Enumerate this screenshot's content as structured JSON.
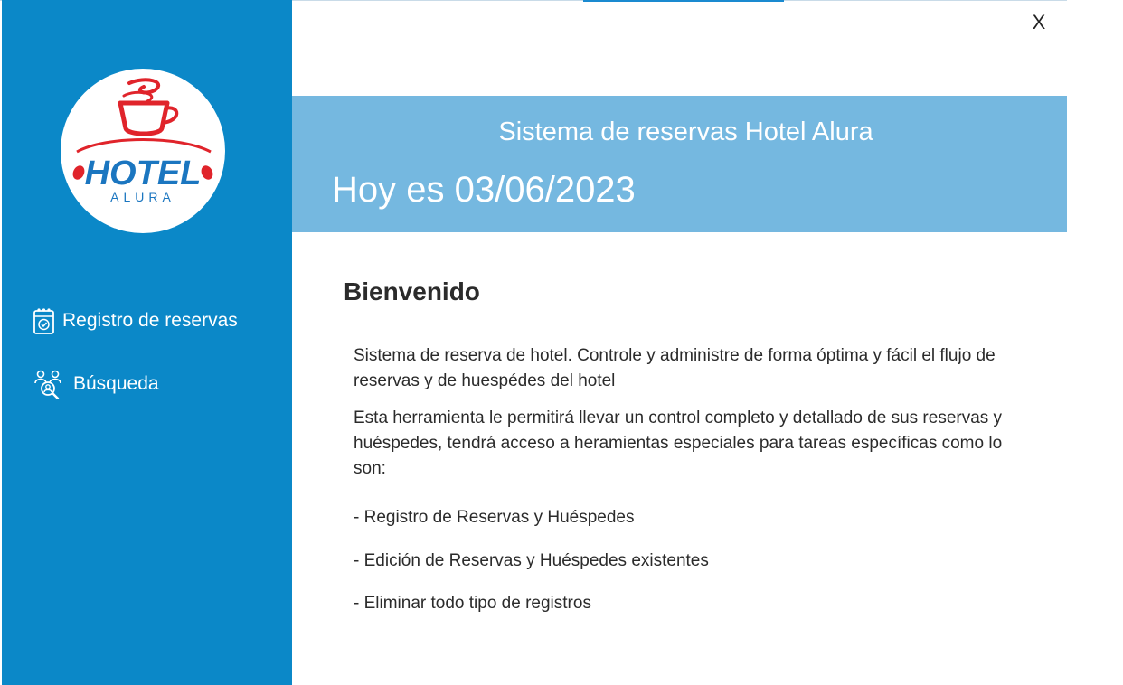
{
  "window": {
    "close_label": "X"
  },
  "sidebar": {
    "logo": {
      "title": "HOTEL",
      "subtitle": "ALURA"
    },
    "items": [
      {
        "label": "Registro de reservas",
        "icon": "reservation-calendar-icon"
      },
      {
        "label": "Búsqueda",
        "icon": "people-search-icon"
      }
    ]
  },
  "header": {
    "title": "Sistema de reservas Hotel Alura",
    "date_text": "Hoy es 03/06/2023"
  },
  "main": {
    "welcome_title": "Bienvenido",
    "paragraph_1": "Sistema de reserva de hotel. Controle y administre de forma óptima y fácil el flujo de reservas y de huespédes del hotel",
    "paragraph_2": "Esta herramienta le permitirá llevar un control completo y detallado de sus reservas y huéspedes, tendrá acceso a heramientas especiales para tareas específicas como lo son:",
    "features": [
      "- Registro de Reservas y Huéspedes",
      "- Edición de Reservas y Huéspedes existentes",
      "- Eliminar todo tipo de registros"
    ]
  },
  "colors": {
    "sidebar_bg": "#0b88c8",
    "header_bg": "#75b8e0",
    "logo_red": "#e0242b",
    "logo_blue": "#1b76c0"
  }
}
